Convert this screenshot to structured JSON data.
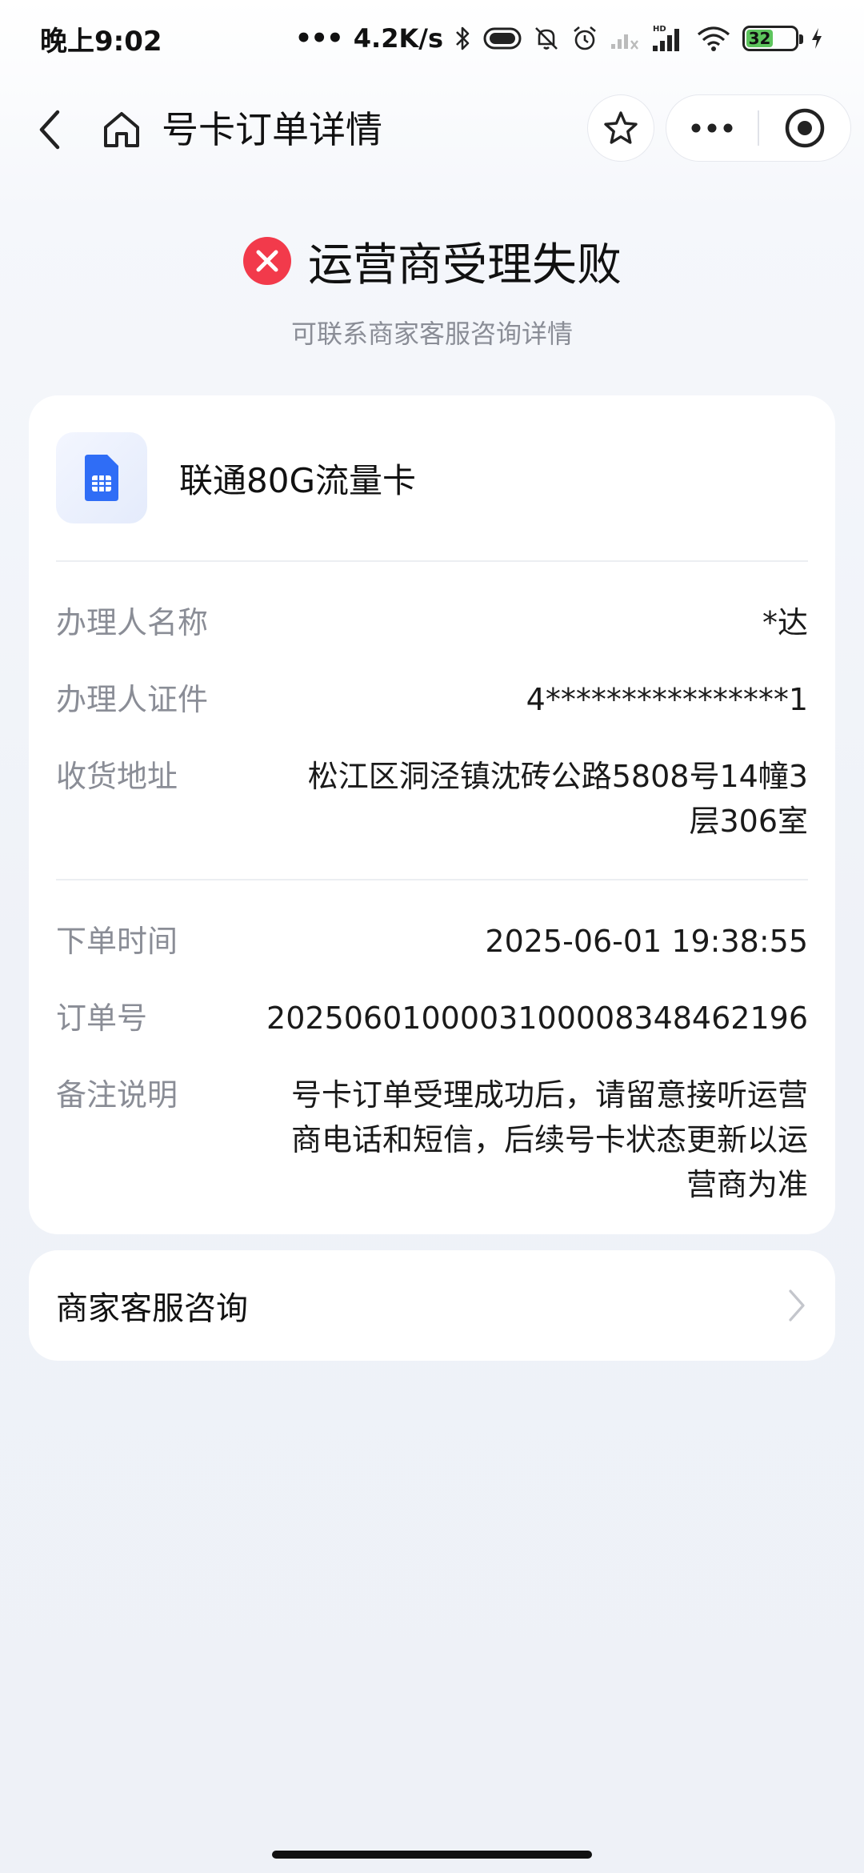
{
  "status_bar": {
    "time": "晚上9:02",
    "network_speed": "4.2K/s",
    "hd_label": "HD",
    "battery_level": "32",
    "battery_fraction": 0.32
  },
  "nav": {
    "title": "号卡订单详情"
  },
  "result": {
    "title": "运营商受理失败",
    "subtitle": "可联系商家客服咨询详情",
    "status_color": "#f23a4b"
  },
  "product": {
    "name": "联通80G流量卡",
    "icon": "sim-card-icon",
    "icon_color": "#2f6df6"
  },
  "applicant_fields": [
    {
      "label": "办理人名称",
      "value": "*达"
    },
    {
      "label": "办理人证件",
      "value": "4****************1"
    },
    {
      "label": "收货地址",
      "value": "松江区洞泾镇沈砖公路5808号14幢3层306室"
    }
  ],
  "order_fields": [
    {
      "label": "下单时间",
      "value": "2025-06-01 19:38:55"
    },
    {
      "label": "订单号",
      "value": "20250601000031000083484621​96"
    },
    {
      "label": "备注说明",
      "value": "号卡订单受理成功后，请留意接听运营商电话和短信，后续号卡状态更新以运营商为准"
    }
  ],
  "service": {
    "label": "商家客服咨询"
  }
}
